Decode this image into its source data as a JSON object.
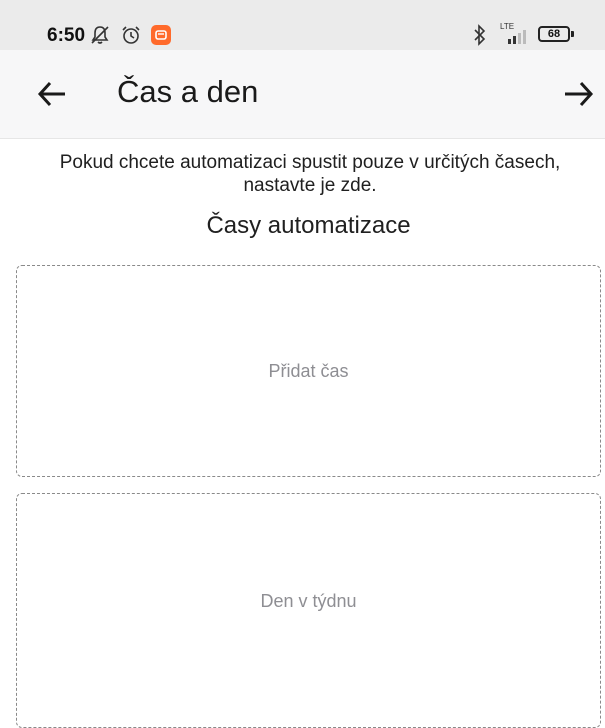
{
  "status_bar": {
    "time": "6:50",
    "network_label": "LTE",
    "battery_level": "68",
    "icons": [
      "silent-icon",
      "alarm-icon",
      "notification-app-icon",
      "bluetooth-icon",
      "signal-icon",
      "battery-icon"
    ],
    "notification_color": "#ff6a2b"
  },
  "app_bar": {
    "title": "Čas a den",
    "back_icon": "arrow-left-icon",
    "next_icon": "arrow-right-icon"
  },
  "content": {
    "description": "Pokud chcete automatizaci spustit pouze v určitých časech, nastavte je zde.",
    "section_title": "Časy automatizace",
    "add_time_label": "Přidat čas",
    "weekday_label": "Den v týdnu"
  }
}
